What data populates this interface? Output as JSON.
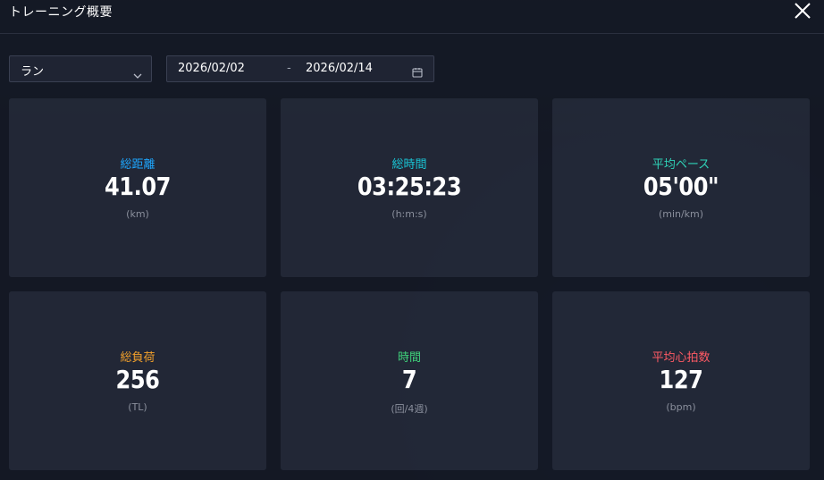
{
  "header": {
    "title": "トレーニング概要"
  },
  "filters": {
    "activity_type": "ラン",
    "date_start": "2026/02/02",
    "date_separator": "-",
    "date_end": "2026/02/14"
  },
  "cards": [
    {
      "label": "総距離",
      "value": "41.07",
      "unit": "(km)",
      "color": "#1ea7ff"
    },
    {
      "label": "総時間",
      "value": "03:25:23",
      "unit": "(h:m:s)",
      "color": "#19c6d6"
    },
    {
      "label": "平均ペース",
      "value": "05'00\"",
      "unit": "(min/km)",
      "color": "#2fd3b8"
    },
    {
      "label": "総負荷",
      "value": "256",
      "unit": "(TL)",
      "color": "#f2a02b"
    },
    {
      "label": "時間",
      "value": "7",
      "unit": "(回/4週)",
      "color": "#3fd07a"
    },
    {
      "label": "平均心拍数",
      "value": "127",
      "unit": "(bpm)",
      "color": "#ff5a64"
    }
  ],
  "icons": {
    "close": "close-icon",
    "chevron": "chevron-down-icon",
    "calendar": "calendar-icon"
  }
}
